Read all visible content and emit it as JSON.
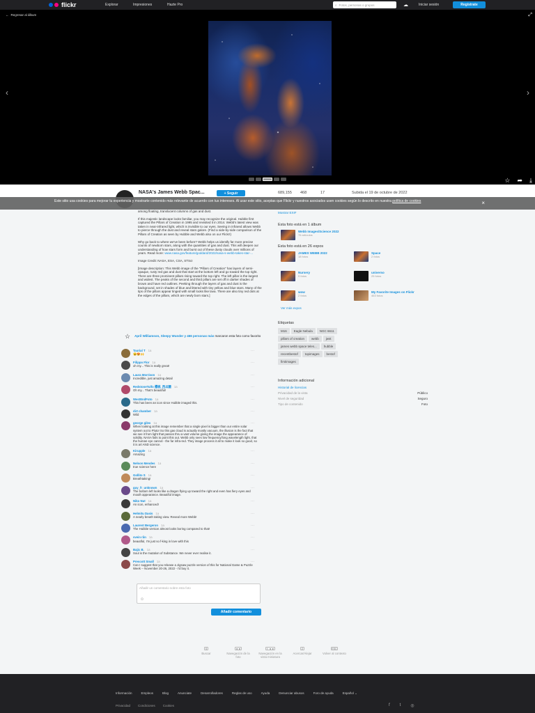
{
  "nav": {
    "brand": "flickr",
    "links": [
      "Explorar",
      "Impresiones",
      "Hazte Pro"
    ],
    "search_placeholder": "Fotos, personas o grupos",
    "signin": "Iniciar sesión",
    "signup": "Regístrate",
    "upload_icon": "cloud-upload-icon"
  },
  "viewer": {
    "back_label": "Regresar al álbum",
    "colors": {
      "bg": "#000000"
    }
  },
  "photo": {
    "title": "NASA's James Webb Spac...",
    "follow": "+ Seguir",
    "views": "689,155",
    "faves": "468",
    "comments": "17",
    "uploaded": "Subida el 19 de octubre de 2022"
  },
  "cookie": {
    "text": "Este sitio usa cookies para mejorar tu experiencia y mostrarte contenido más relevante de acuerdo con tus intereses. Al usar este sitio, aceptas que Flickr y nuestros asociados usen cookies según lo descrito en nuestra",
    "link": "política de cookies",
    "close": "×"
  },
  "description": [
    "among floating, translucent columns of gas and dust.",
    "If this majestic landscape looks familiar, you may recognize the original. Hubble first captured the Pillars of Creation in 1995 and revisited it in 2014. Webb's latest view was taken in near-infrared light, which is invisible to our eyes. Seeing in infrared allows Webb to pierce through the dust and reveal stars galore. (Find a side-by-side comparison of the Pillars of Creation as seen by Hubble and Webb also on our Flickr!)",
    "Why go back to where we've been before? Webb helps us identify far more precise counts of newborn stars, along with the quantities of gas and dust. This will deepen our understanding of how stars form and burst out of these dusty clouds over millions of years.",
    "Image Credit: NASA, ESA, CSA, STScI",
    "[Image description: This Webb image of the \"Pillars of Creation\" has layers of semi-opaque, rusty red gas and dust that start at the bottom left and go toward the top right. There are three prominent pillars rising toward the top right. The left pillar is the largest and widest. The peaks of the second and third pillars are set off in darker shades of brown and have red outlines. Peeking through the layers of gas and dust is the background, set in shades of blue and littered with tiny yellow and blue stars. Many of the tips of the pillars appear tinged with small looks like lava. There are also tiny red dots at the edges of the pillars, which are newly born stars.]"
  ],
  "read_more": {
    "label": "Read more:",
    "link": "www.nasa.gov/feature/goddard/2022/nasa-s-webb-takes-star-..."
  },
  "side": {
    "exif": "Mostrar EXIF",
    "album_heading": "Esta foto está en 1 álbum",
    "album": {
      "title": "Webb Images/Science 2022",
      "sub": "76 artículos"
    },
    "pools_heading": "Esta foto está en 26 expos",
    "pools": [
      {
        "title": "JAMES WEBB 2022",
        "sub": "18 fotos"
      },
      {
        "title": "Space",
        "sub": "2 fotos"
      },
      {
        "title": "Nursery",
        "sub": "9 fotos"
      },
      {
        "title": "universo",
        "sub": "25 fotos"
      },
      {
        "title": "wow",
        "sub": "2 fotos"
      },
      {
        "title": "My Favorite Images on Flickr",
        "sub": "463 fotos"
      }
    ],
    "see_all": "Ver más expos",
    "tags_heading": "Etiquetas",
    "tags": [
      "M16",
      "Eagle Nebula",
      "NGC 6611",
      "pillars of creation",
      "webb",
      "jwst",
      "james webb space teles...",
      "hubble",
      "recentbestof",
      "topimages",
      "bestof",
      "firstimages"
    ],
    "info_heading": "Información adicional",
    "info": [
      {
        "label": "Historial de licencias",
        "value": ""
      },
      {
        "label": "Privacidad de la vista",
        "value": "Público"
      },
      {
        "label": "Nivel de seguridad",
        "value": "Seguro"
      },
      {
        "label": "Tipo de contenido",
        "value": "Foto"
      }
    ]
  },
  "faves_line": {
    "names": "April Williamson, Sleepy Wunder y 466 personas más",
    "rest": "marcaron esta foto como favorito"
  },
  "comments": [
    {
      "name": "Taurial T",
      "time": "1a",
      "text": "😮😍🙌",
      "color": "#8a6d3b"
    },
    {
      "name": "Filippo Flor",
      "time": "1a",
      "text": "oh my... This is really great!",
      "color": "#4a4a4a"
    },
    {
      "name": "Laura Morrison",
      "time": "1a",
      "text": "Incredible, just amazing detail",
      "color": "#6a8ab0"
    },
    {
      "name": "RedstoneTulfo 樱桃_西瓜糖",
      "time": "1a",
      "text": "Oh my... That's beautiful!",
      "color": "#b04a6a"
    },
    {
      "name": "WestEndFoto",
      "time": "1a",
      "text": "This has been an icon since Hubble imaged this.",
      "color": "#2a6a8a"
    },
    {
      "name": "dirt chamber",
      "time": "1a",
      "text": "Wild",
      "color": "#333"
    },
    {
      "name": "george giles",
      "time": "1a",
      "text": "When looking at this image remember that a single pixel is bigger than our entire solar system out to Pluto! So this gas cloud is actually mostly vacuum, the illusion is the fact that we see it from light that passes thru a vast volume giving the image the appearance of solidity. NASA fails to point this out. Webb only sees low frequency/long wavelength light, that the human eye cannot - the far infra-red. They image process it all to make it look so good, so it is art AND science.",
      "color": "#8a3a6a"
    },
    {
      "name": "Kirupple",
      "time": "1a",
      "text": "Amazing",
      "color": "#7a7a6a"
    },
    {
      "name": "Nelson Mendes",
      "time": "1a",
      "text": "true science here",
      "color": "#5a8a5a"
    },
    {
      "name": "Gollito S",
      "time": "1a",
      "text": "Breathtaking!",
      "color": "#c08a5a"
    },
    {
      "name": "guy_fr_unknown",
      "time": "1a",
      "text": "The bottom left looks like a dragon flying up toward the right and even has fiery eyes and mouth appearance. Beautiful image.",
      "color": "#6a4a8a"
    },
    {
      "name": "Niko Nut",
      "time": "1a",
      "text": "An icon, enhanced!",
      "color": "#3a3a3a"
    },
    {
      "name": "Helmitu Dasis",
      "time": "1a",
      "text": "A nearly breath taking view. Reveal more Webb!",
      "color": "#5a6a3a"
    },
    {
      "name": "Laurent Bergeron",
      "time": "1a",
      "text": "The Hubble version almost looks boring compared to that!",
      "color": "#4a6ab0"
    },
    {
      "name": "svein rån",
      "time": "1a",
      "text": "beautiful, I'm just so f-king in love with this",
      "color": "#b05a8a"
    },
    {
      "name": "Bajic B.",
      "time": "1a",
      "text": "Soul is the mutation of Substance. We never ever realise it.",
      "color": "#444"
    },
    {
      "name": "Prescott Small",
      "time": "1a",
      "text": "Can I suggest that you release a Jigsaw puzzle version of this for National Game & Puzzle Week -- November 20-26, 2022 - I'd buy it.",
      "color": "#8a4a4a"
    }
  ],
  "comment_box": {
    "placeholder": "Añadir un comentario sobre esta foto",
    "button": "Añadir comentario"
  },
  "shortcuts": [
    {
      "key": "S",
      "label": "Buscar"
    },
    {
      "key": "◄ ►",
      "label": "Navegación de la foto"
    },
    {
      "key": "⇧ ◄ ►",
      "label": "Navegación en la vista miniatura"
    },
    {
      "key": "Z",
      "label": "Acercar/Alejar"
    },
    {
      "key": "ESC",
      "label": "Volver al contexto"
    }
  ],
  "footer": {
    "links": [
      "Información",
      "Empleos",
      "Blog",
      "Anunciate",
      "Desarrolladores",
      "Reglas de uso",
      "Ayuda",
      "Denunciar abusos",
      "Foro de ayuda",
      "Español ⌄"
    ],
    "links2": [
      "Privacidad",
      "Condiciones",
      "Cookies"
    ]
  }
}
